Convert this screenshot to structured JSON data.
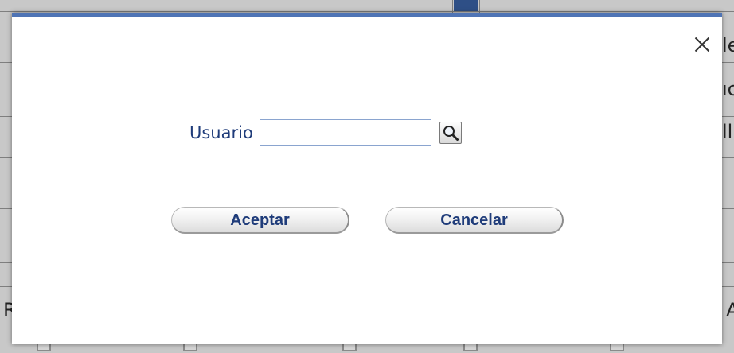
{
  "background": {
    "right_fragments": [
      "le",
      "ıc",
      "ll"
    ],
    "bottom_left_fragment": "R",
    "bottom_right_fragment": "A"
  },
  "dialog": {
    "user_label": "Usuario",
    "user_value": "",
    "accept_label": "Aceptar",
    "cancel_label": "Cancelar"
  },
  "colors": {
    "dialog_border": "#4f74b5",
    "label_text": "#1f3c7a",
    "input_border": "#8aa4cf"
  }
}
